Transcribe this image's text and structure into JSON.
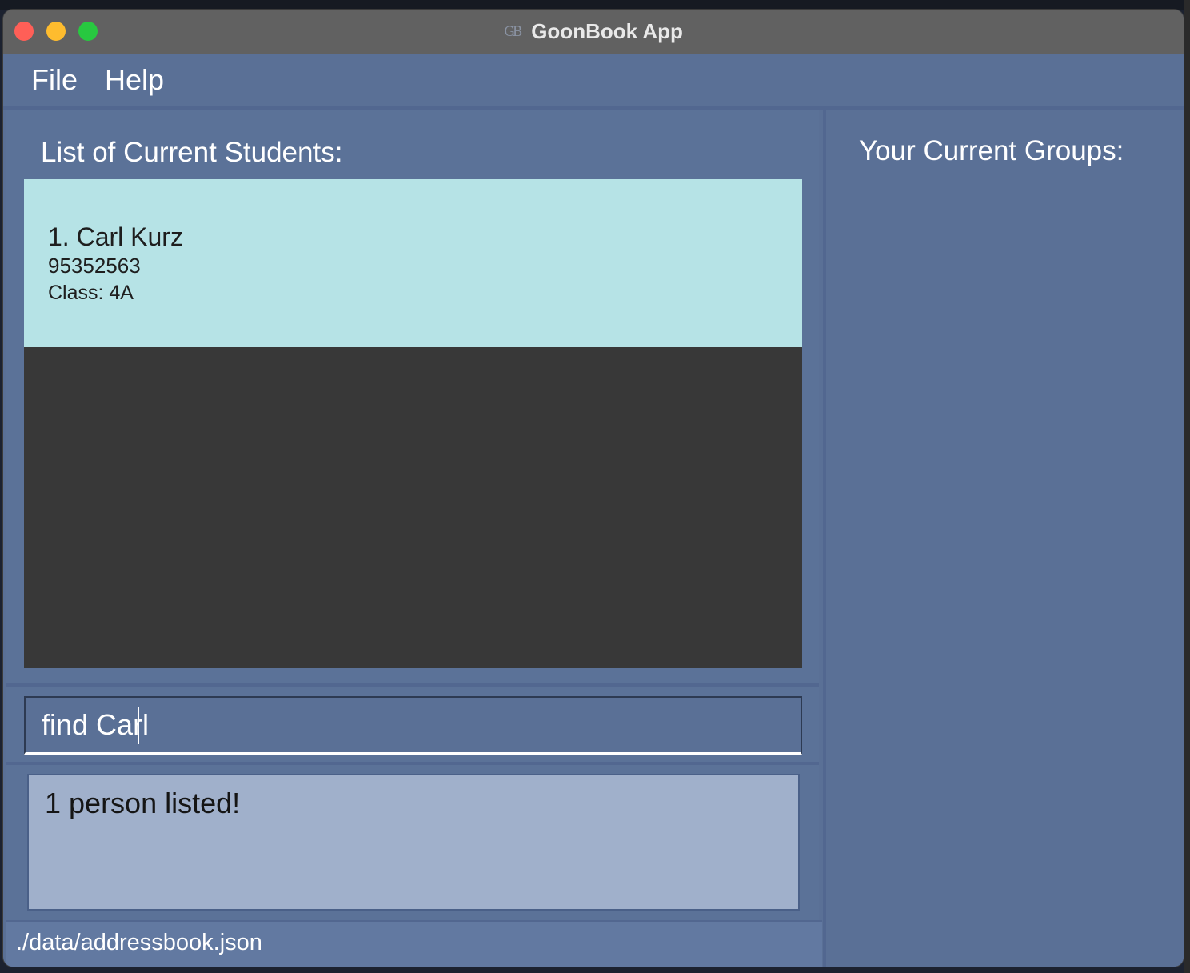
{
  "window": {
    "title": "GoonBook App",
    "logo_text": "GB"
  },
  "menu": {
    "file_label": "File",
    "help_label": "Help"
  },
  "students_panel": {
    "heading": "List of Current Students:",
    "students": [
      {
        "name": "1. Carl Kurz",
        "phone": "95352563",
        "class": "Class: 4A"
      }
    ]
  },
  "groups_panel": {
    "heading": "Your Current Groups:"
  },
  "command": {
    "value": "find Carl"
  },
  "result": {
    "text": "1 person listed!"
  },
  "status": {
    "file_path": "./data/addressbook.json"
  },
  "colors": {
    "window_bg": "#5a7096",
    "title_bar": "#616161",
    "card_bg": "#b6e3e6",
    "list_bg": "#383838",
    "result_bg": "#a0b0cb"
  }
}
